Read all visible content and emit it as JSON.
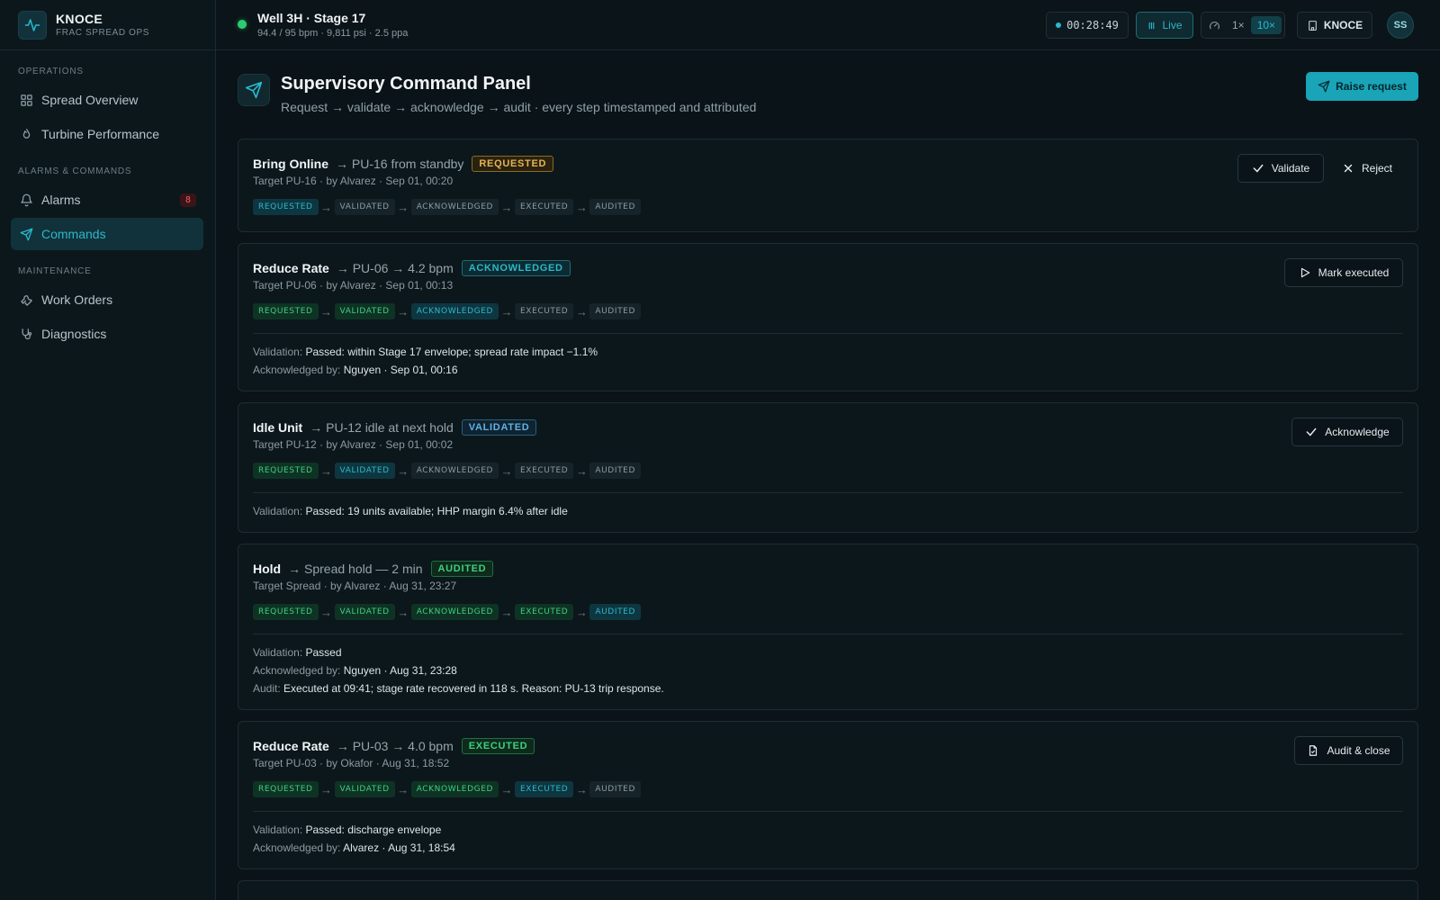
{
  "brand": {
    "name": "KNOCE",
    "subtitle": "FRAC SPREAD OPS"
  },
  "sidebar": {
    "sections": [
      {
        "label": "OPERATIONS"
      },
      {
        "label": "ALARMS & COMMANDS"
      },
      {
        "label": "MAINTENANCE"
      }
    ],
    "items": [
      {
        "label": "Spread Overview",
        "icon": "grid-icon"
      },
      {
        "label": "Turbine Performance",
        "icon": "flame-icon"
      },
      {
        "label": "Alarms",
        "icon": "bell-icon",
        "badge": "8"
      },
      {
        "label": "Commands",
        "icon": "send-icon",
        "active": true
      },
      {
        "label": "Work Orders",
        "icon": "wrench-icon"
      },
      {
        "label": "Diagnostics",
        "icon": "stethoscope-icon"
      }
    ]
  },
  "topbar": {
    "well_title": "Well 3H · Stage 17",
    "well_sub": "94.4 / 95 bpm · 9,811 psi · 2.5 ppa",
    "timer": "00:28:49",
    "live_label": "Live",
    "speed_options": [
      "1×",
      "10×"
    ],
    "speed_selected": "10×",
    "tenant": "KNOCE",
    "avatar": "SS"
  },
  "page": {
    "title": "Supervisory Command Panel",
    "subtitle": "Request → validate → acknowledge → audit · every step timestamped and attributed",
    "raise_label": "Raise request"
  },
  "steps_labels": [
    "REQUESTED",
    "VALIDATED",
    "ACKNOWLEDGED",
    "EXECUTED",
    "AUDITED"
  ],
  "commands": [
    {
      "action": "Bring Online",
      "detail": "→ PU-16 from standby",
      "status": "REQUESTED",
      "meta": "Target PU-16 · by Alvarez · Sep 01, 00:20",
      "steps": [
        "cur",
        "todo",
        "todo",
        "todo",
        "todo"
      ],
      "buttons": [
        "Validate",
        "Reject"
      ],
      "lines": []
    },
    {
      "action": "Reduce Rate",
      "detail": "→ PU-06 → 4.2 bpm",
      "status": "ACKNOWLEDGED",
      "meta": "Target PU-06 · by Alvarez · Sep 01, 00:13",
      "steps": [
        "done",
        "done",
        "cur",
        "todo",
        "todo"
      ],
      "buttons": [
        "Mark executed"
      ],
      "lines": [
        {
          "k": "Validation:",
          "v": "Passed: within Stage 17 envelope; spread rate impact −1.1%"
        },
        {
          "k": "Acknowledged by:",
          "v": "Nguyen · Sep 01, 00:16"
        }
      ]
    },
    {
      "action": "Idle Unit",
      "detail": "→ PU-12 idle at next hold",
      "status": "VALIDATED",
      "meta": "Target PU-12 · by Alvarez · Sep 01, 00:02",
      "steps": [
        "done",
        "cur",
        "todo",
        "todo",
        "todo"
      ],
      "buttons": [
        "Acknowledge"
      ],
      "lines": [
        {
          "k": "Validation:",
          "v": "Passed: 19 units available; HHP margin 6.4% after idle"
        }
      ]
    },
    {
      "action": "Hold",
      "detail": "→ Spread hold — 2 min",
      "status": "AUDITED",
      "meta": "Target Spread · by Alvarez · Aug 31, 23:27",
      "steps": [
        "done",
        "done",
        "done",
        "done",
        "cur"
      ],
      "buttons": [],
      "lines": [
        {
          "k": "Validation:",
          "v": "Passed"
        },
        {
          "k": "Acknowledged by:",
          "v": "Nguyen · Aug 31, 23:28"
        },
        {
          "k": "Audit:",
          "v": "Executed at 09:41; stage rate recovered in 118 s. Reason: PU-13 trip response."
        }
      ]
    },
    {
      "action": "Reduce Rate",
      "detail": "→ PU-03 → 4.0 bpm",
      "status": "EXECUTED",
      "meta": "Target PU-03 · by Okafor · Aug 31, 18:52",
      "steps": [
        "done",
        "done",
        "done",
        "cur",
        "todo"
      ],
      "buttons": [
        "Audit & close"
      ],
      "lines": [
        {
          "k": "Validation:",
          "v": "Passed: discharge envelope"
        },
        {
          "k": "Acknowledged by:",
          "v": "Alvarez · Aug 31, 18:54"
        }
      ]
    }
  ],
  "colors": {
    "accent": "#1aa4b8",
    "bg": "#0a1317",
    "success": "#3fcf7f",
    "warning": "#e5b552",
    "danger": "#f05a5a"
  }
}
